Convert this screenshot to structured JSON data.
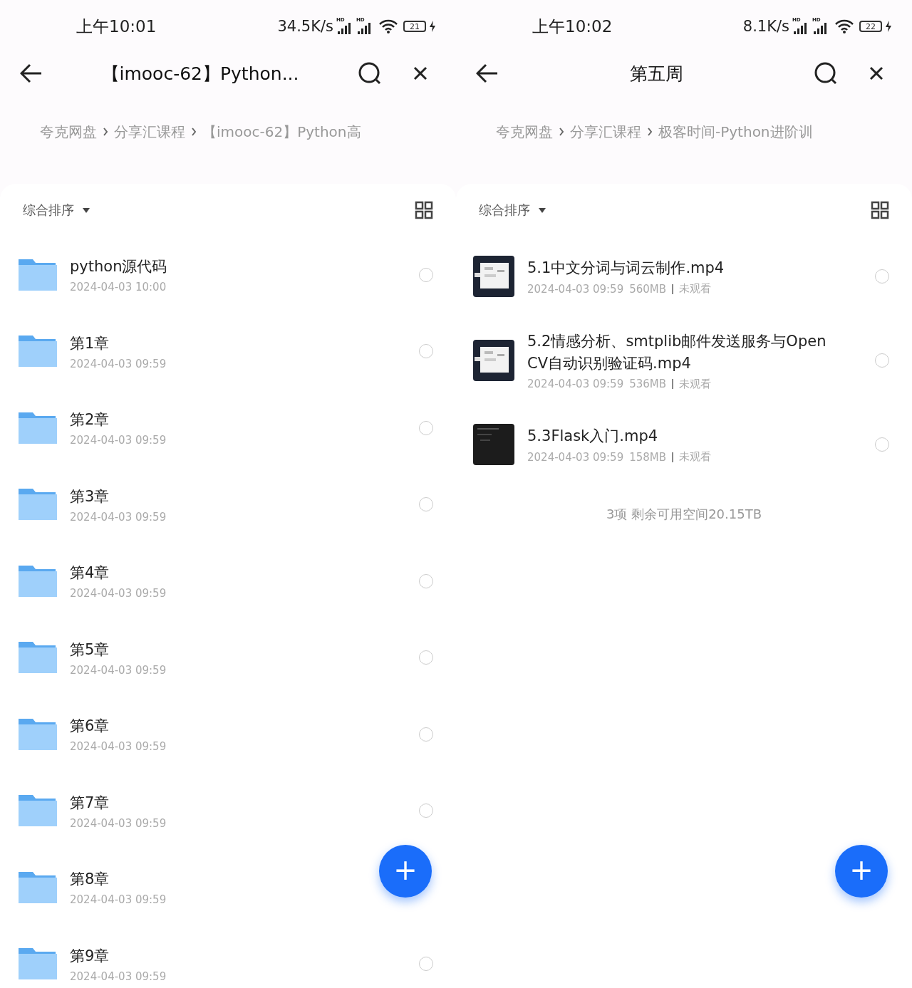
{
  "screens": [
    {
      "status_bar": {
        "time": "上午10:01",
        "speed": "34.5K/s",
        "signals": [
          {
            "label": "HD"
          },
          {
            "label": "HD"
          }
        ],
        "battery": "21"
      },
      "header": {
        "title": "【imooc-62】Python..."
      },
      "breadcrumb": [
        "夸克网盘",
        "分享汇课程",
        "【imooc-62】Python高"
      ],
      "sort": {
        "label": "综合排序"
      },
      "items": [
        {
          "kind": "folder",
          "name": "python源代码",
          "date": "2024-04-03 10:00",
          "selected": false
        },
        {
          "kind": "folder",
          "name": "第1章",
          "date": "2024-04-03 09:59",
          "selected": false
        },
        {
          "kind": "folder",
          "name": "第2章",
          "date": "2024-04-03 09:59",
          "selected": false
        },
        {
          "kind": "folder",
          "name": "第3章",
          "date": "2024-04-03 09:59",
          "selected": false
        },
        {
          "kind": "folder",
          "name": "第4章",
          "date": "2024-04-03 09:59",
          "selected": false
        },
        {
          "kind": "folder",
          "name": "第5章",
          "date": "2024-04-03 09:59",
          "selected": false
        },
        {
          "kind": "folder",
          "name": "第6章",
          "date": "2024-04-03 09:59",
          "selected": false
        },
        {
          "kind": "folder",
          "name": "第7章",
          "date": "2024-04-03 09:59",
          "selected": false
        },
        {
          "kind": "folder",
          "name": "第8章",
          "date": "2024-04-03 09:59"
        },
        {
          "kind": "folder",
          "name": "第9章",
          "date": "2024-04-03 09:59",
          "selected": false
        }
      ],
      "fab": {
        "label": "+"
      }
    },
    {
      "status_bar": {
        "time": "上午10:02",
        "speed": "8.1K/s",
        "signals": [
          {
            "label": "HD"
          },
          {
            "label": "HD"
          }
        ],
        "battery": "22"
      },
      "header": {
        "title": "第五周"
      },
      "breadcrumb": [
        "夸克网盘",
        "分享汇课程",
        "极客时间-Python进阶训"
      ],
      "sort": {
        "label": "综合排序"
      },
      "items": [
        {
          "kind": "video",
          "name": "5.1中文分词与词云制作.mp4",
          "date": "2024-04-03 09:59",
          "size": "560MB",
          "status": "未观看",
          "selected": false
        },
        {
          "kind": "video",
          "name": "5.2情感分析、smtplib邮件发送服务与OpenCV自动识别验证码.mp4",
          "date": "2024-04-03 09:59",
          "size": "536MB",
          "status": "未观看",
          "selected": false
        },
        {
          "kind": "video",
          "name": "5.3Flask入门.mp4",
          "date": "2024-04-03 09:59",
          "size": "158MB",
          "status": "未观看",
          "selected": false
        }
      ],
      "footer": "3项 剩余可用空间20.15TB",
      "fab": {
        "label": "+"
      }
    }
  ]
}
